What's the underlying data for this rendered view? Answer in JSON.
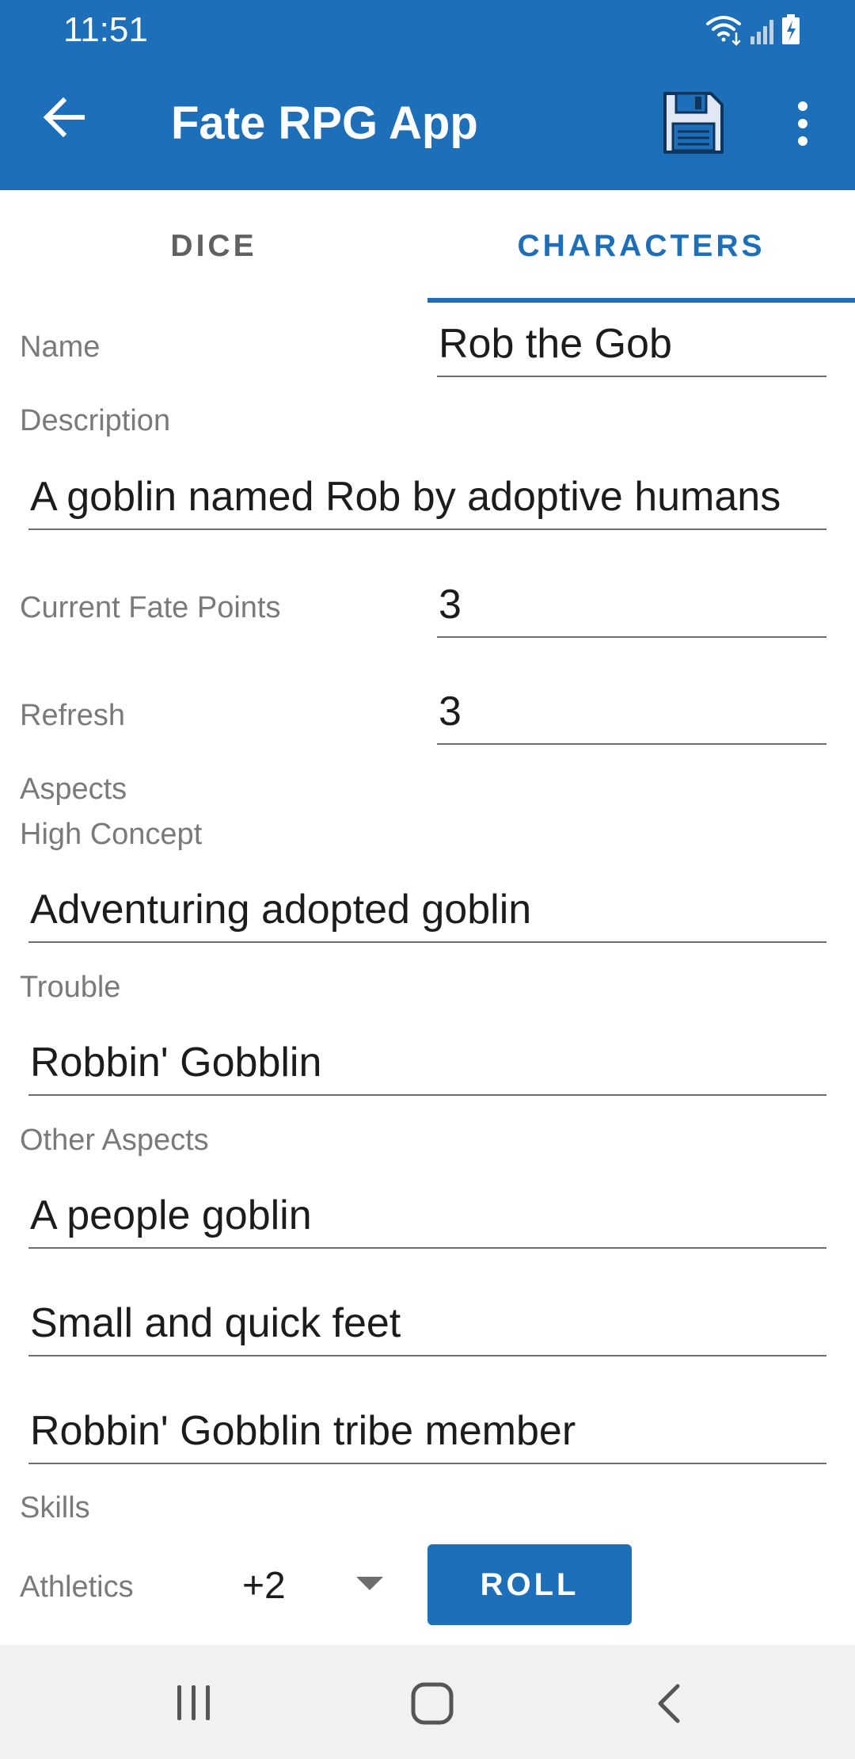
{
  "status_bar": {
    "time": "11:51"
  },
  "app_bar": {
    "title": "Fate RPG App"
  },
  "tabs": [
    {
      "label": "DICE",
      "selected": false
    },
    {
      "label": "CHARACTERS",
      "selected": true
    }
  ],
  "character": {
    "name_label": "Name",
    "name_value": "Rob the Gob",
    "description_label": "Description",
    "description_value": "A goblin named Rob by adoptive humans",
    "fate_points_label": "Current Fate Points",
    "fate_points_value": "3",
    "refresh_label": "Refresh",
    "refresh_value": "3",
    "aspects_label": "Aspects",
    "high_concept_label": "High Concept",
    "high_concept_value": "Adventuring adopted goblin",
    "trouble_label": "Trouble",
    "trouble_value": "Robbin' Gobblin",
    "other_aspects_label": "Other Aspects",
    "other_aspects": [
      "A people goblin",
      "Small and quick feet",
      "Robbin' Gobblin tribe member"
    ],
    "skills_label": "Skills",
    "skill": {
      "name": "Athletics",
      "value": "+2",
      "roll_label": "ROLL"
    }
  },
  "colors": {
    "primary": "#1e6fba",
    "nav_background": "#f1f1f1"
  },
  "icons": [
    "back-arrow-icon",
    "save-icon",
    "more-vert-icon",
    "wifi-icon",
    "signal-icon",
    "battery-icon",
    "recent-apps-icon",
    "home-icon",
    "nav-back-icon"
  ]
}
